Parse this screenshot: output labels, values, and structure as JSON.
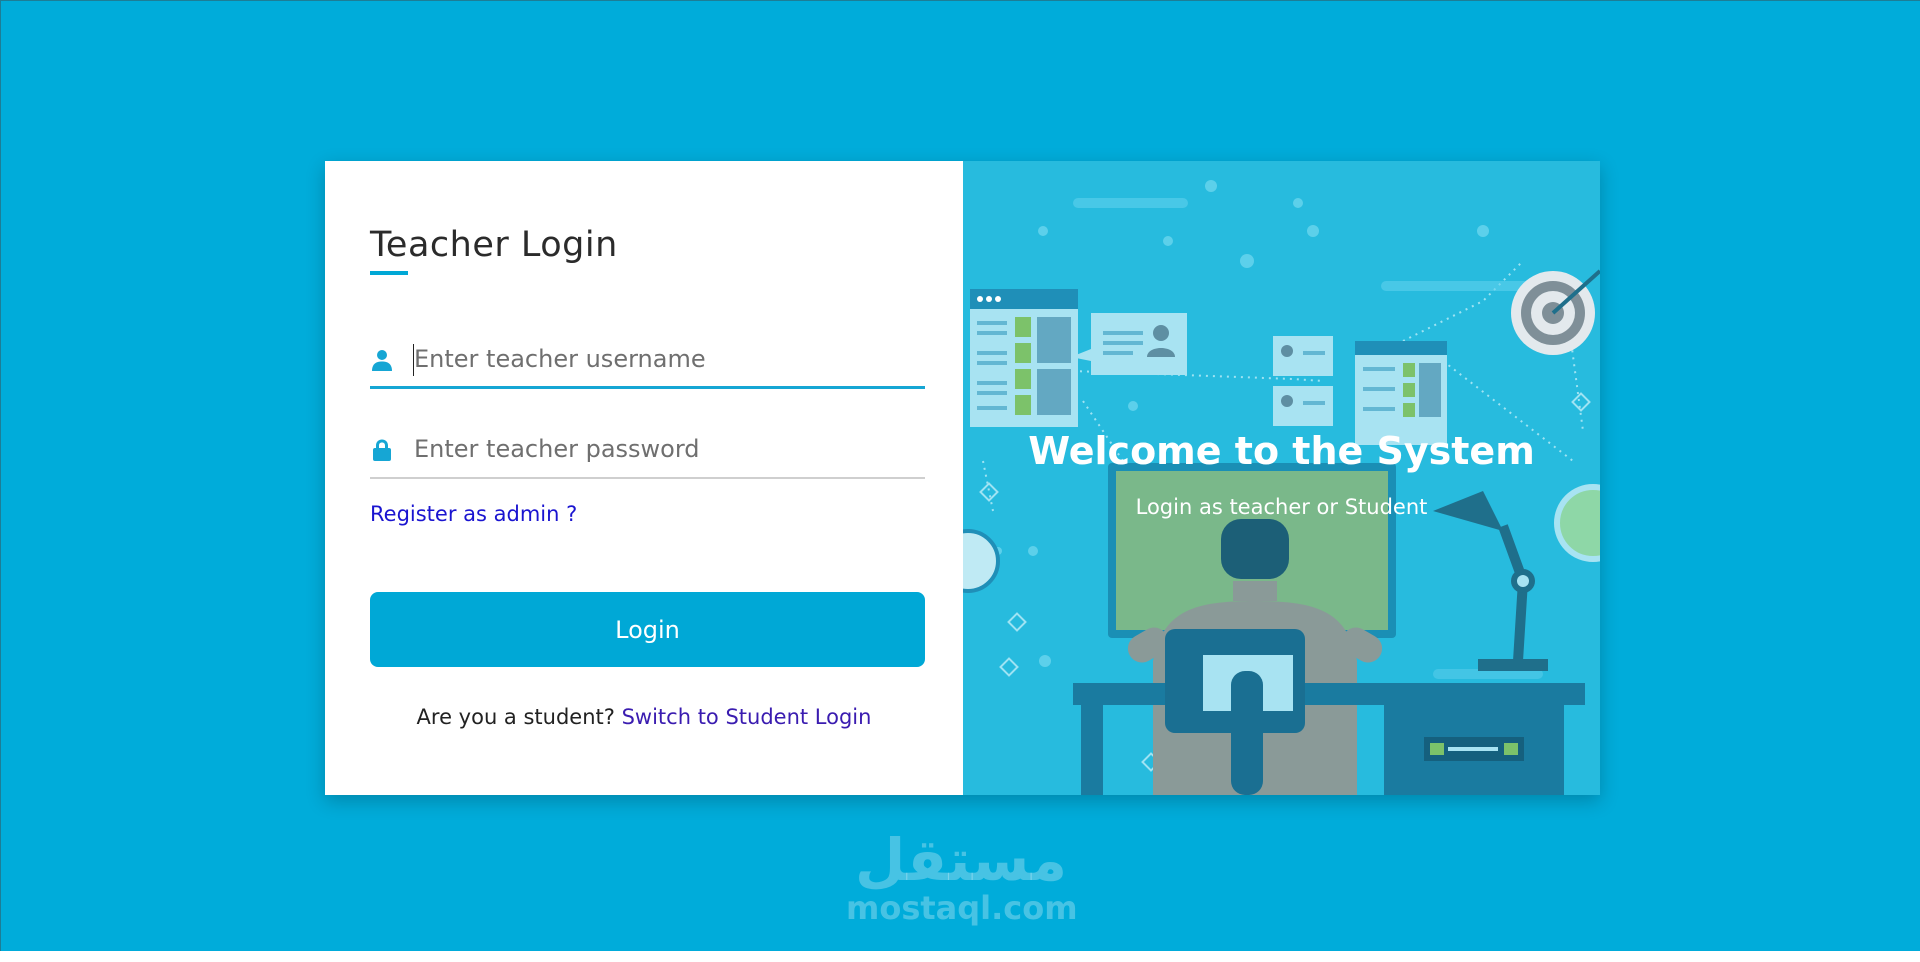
{
  "login_form": {
    "title": "Teacher Login",
    "username_placeholder": "Enter teacher username",
    "password_placeholder": "Enter teacher password",
    "register_link": "Register as admin ?",
    "login_button": "Login",
    "switch_prompt": "Are you a student?",
    "switch_link": "Switch to Student Login",
    "icons": [
      "user-icon",
      "lock-icon"
    ]
  },
  "welcome_panel": {
    "title": "Welcome to the System",
    "subtitle": "Login as teacher or Student"
  },
  "watermark": {
    "arabic": "مستقل",
    "latin": "mostaql.com"
  },
  "colors": {
    "background": "#00acda",
    "accent": "#00a8d6",
    "register_link": "#1a14d0",
    "switch_link": "#3a1cb0",
    "illustration_bg": "#27bbde"
  }
}
